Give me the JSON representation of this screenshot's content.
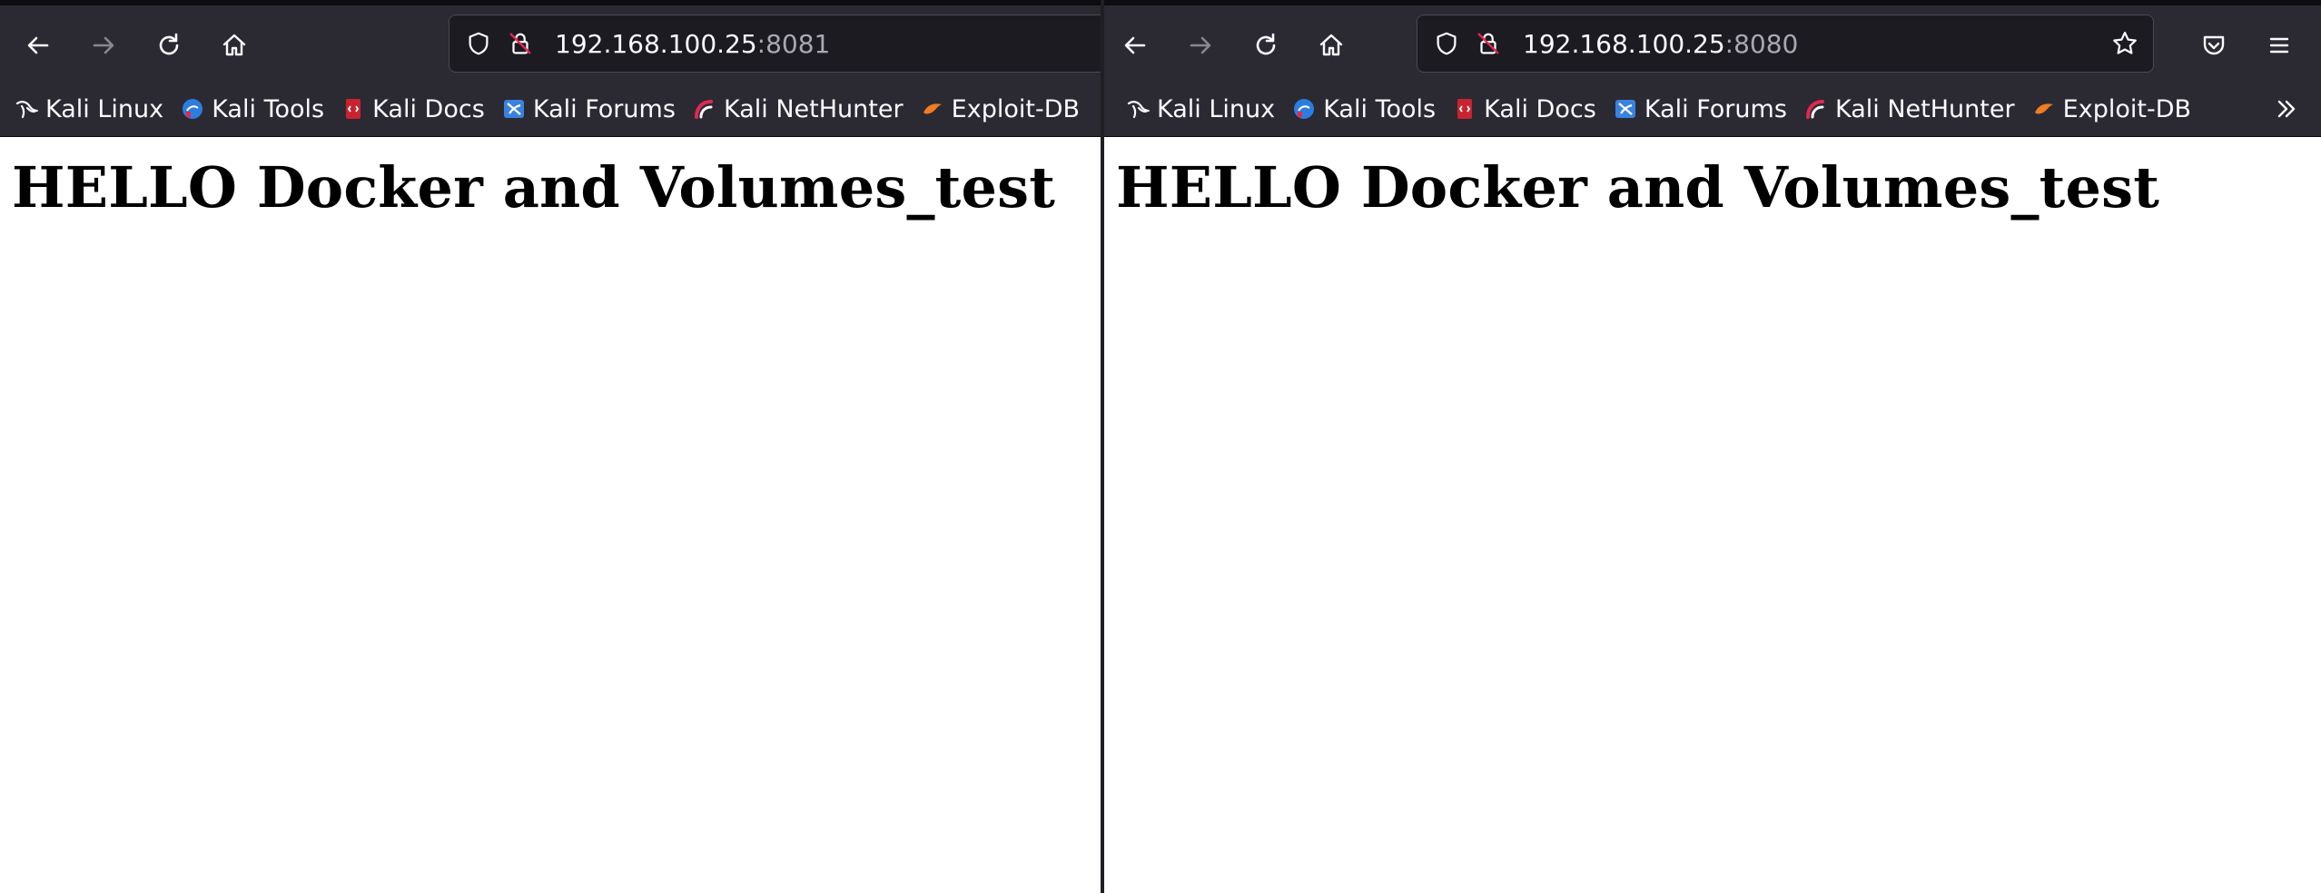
{
  "colors": {
    "toolbar_bg": "#2b2a33",
    "urlbar_bg": "#1c1b22",
    "text_light": "#fbfbfe",
    "port_grey": "#a8a8b0",
    "page_bg": "#ffffff"
  },
  "bookmarks": [
    {
      "label": "Kali Linux",
      "icon": "kali-dragon-icon"
    },
    {
      "label": "Kali Tools",
      "icon": "kali-tools-icon"
    },
    {
      "label": "Kali Docs",
      "icon": "kali-docs-icon"
    },
    {
      "label": "Kali Forums",
      "icon": "kali-forums-icon"
    },
    {
      "label": "Kali NetHunter",
      "icon": "kali-nethunter-icon"
    },
    {
      "label": "Exploit-DB",
      "icon": "exploit-db-icon"
    }
  ],
  "left_window": {
    "url_host": "192.168.100.25",
    "url_port": ":8081",
    "heading": "HELLO Docker and Volumes_test"
  },
  "right_window": {
    "url_host": "192.168.100.25",
    "url_port": ":8080",
    "heading": "HELLO Docker and Volumes_test"
  }
}
